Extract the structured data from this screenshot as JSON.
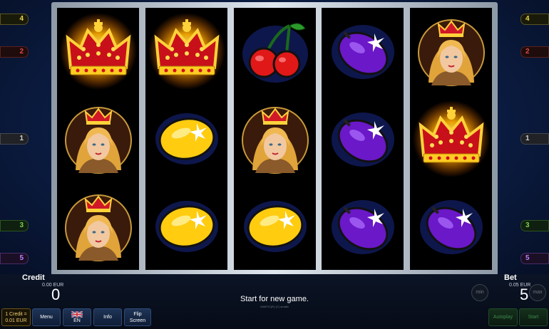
{
  "markers_left": [
    {
      "number": "4",
      "color": "yellow"
    },
    {
      "number": "2",
      "color": "red"
    },
    {
      "number": "1",
      "color": "gray"
    },
    {
      "number": "3",
      "color": "green"
    },
    {
      "number": "5",
      "color": "purple"
    }
  ],
  "markers_right": [
    {
      "number": "4",
      "color": "yellow"
    },
    {
      "number": "2",
      "color": "red"
    },
    {
      "number": "1",
      "color": "gray"
    },
    {
      "number": "3",
      "color": "green"
    },
    {
      "number": "5",
      "color": "purple"
    }
  ],
  "reels": [
    [
      "crown",
      "lady",
      "lady"
    ],
    [
      "crown",
      "lemon",
      "lemon"
    ],
    [
      "cherries",
      "lady",
      "lemon"
    ],
    [
      "plum",
      "plum",
      "plum"
    ],
    [
      "lady",
      "crown",
      "plum"
    ]
  ],
  "credit": {
    "label": "Credit",
    "eur": "0.00 EUR",
    "value": "0"
  },
  "bet": {
    "label": "Bet",
    "eur": "0.05 EUR",
    "value": "5",
    "min_label": "min",
    "max_label": "max"
  },
  "message": "Start for new game.",
  "fine_print": "AMATIC(R) (C) amatic",
  "denomination": {
    "line1": "1 Credit =",
    "line2": "0.01 EUR"
  },
  "buttons": {
    "menu": "Menu",
    "language": "EN",
    "info": "Info",
    "flip_line1": "Flip",
    "flip_line2": "Screen",
    "autoplay": "Autoplay",
    "start": "Start"
  }
}
